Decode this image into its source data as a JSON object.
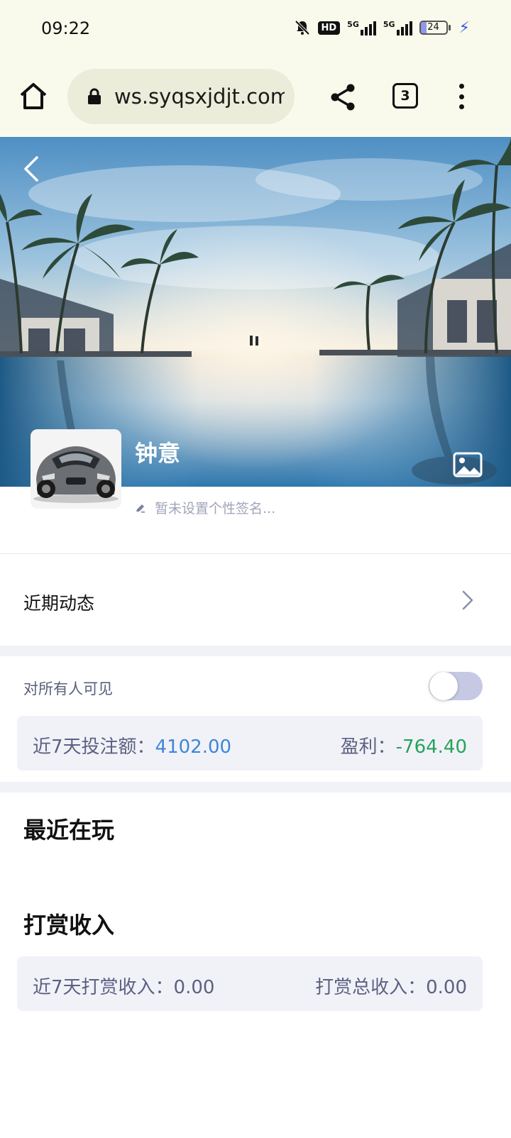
{
  "status_bar": {
    "time": "09:22",
    "network_1": "5G",
    "network_2": "5G",
    "hd": "HD",
    "battery": "24",
    "battery_fraction": 0.24,
    "icons": [
      "bell-muted-icon",
      "hd-icon",
      "signal-icon",
      "signal-icon",
      "battery-icon",
      "charging-icon"
    ]
  },
  "browser": {
    "url": "ws.syqsxjdjt.com",
    "tab_count": "3",
    "icons": [
      "home-icon",
      "lock-icon",
      "share-icon",
      "menu-icon"
    ]
  },
  "profile": {
    "username": "钟意",
    "signature_placeholder": "暂未设置个性签名...",
    "icons": [
      "back-icon",
      "image-icon",
      "pencil-icon"
    ]
  },
  "recent_activity": {
    "label": "近期动态"
  },
  "visibility": {
    "label": "对所有人可见",
    "enabled": false
  },
  "betting_stats": {
    "bet_label": "近7天投注额：",
    "bet_value": "4102.00",
    "profit_label": "盈利：",
    "profit_value": "-764.40"
  },
  "recently_playing": {
    "title": "最近在玩"
  },
  "tips_income": {
    "title": "打赏收入",
    "week_label": "近7天打赏收入：",
    "week_value": "0.00",
    "total_label": "打赏总收入：",
    "total_value": "0.00"
  },
  "colors": {
    "accent_blue": "#3e86d8",
    "profit_green": "#26a35a",
    "panel_bg": "#f1f2f8",
    "browser_bg": "#fafaec"
  }
}
